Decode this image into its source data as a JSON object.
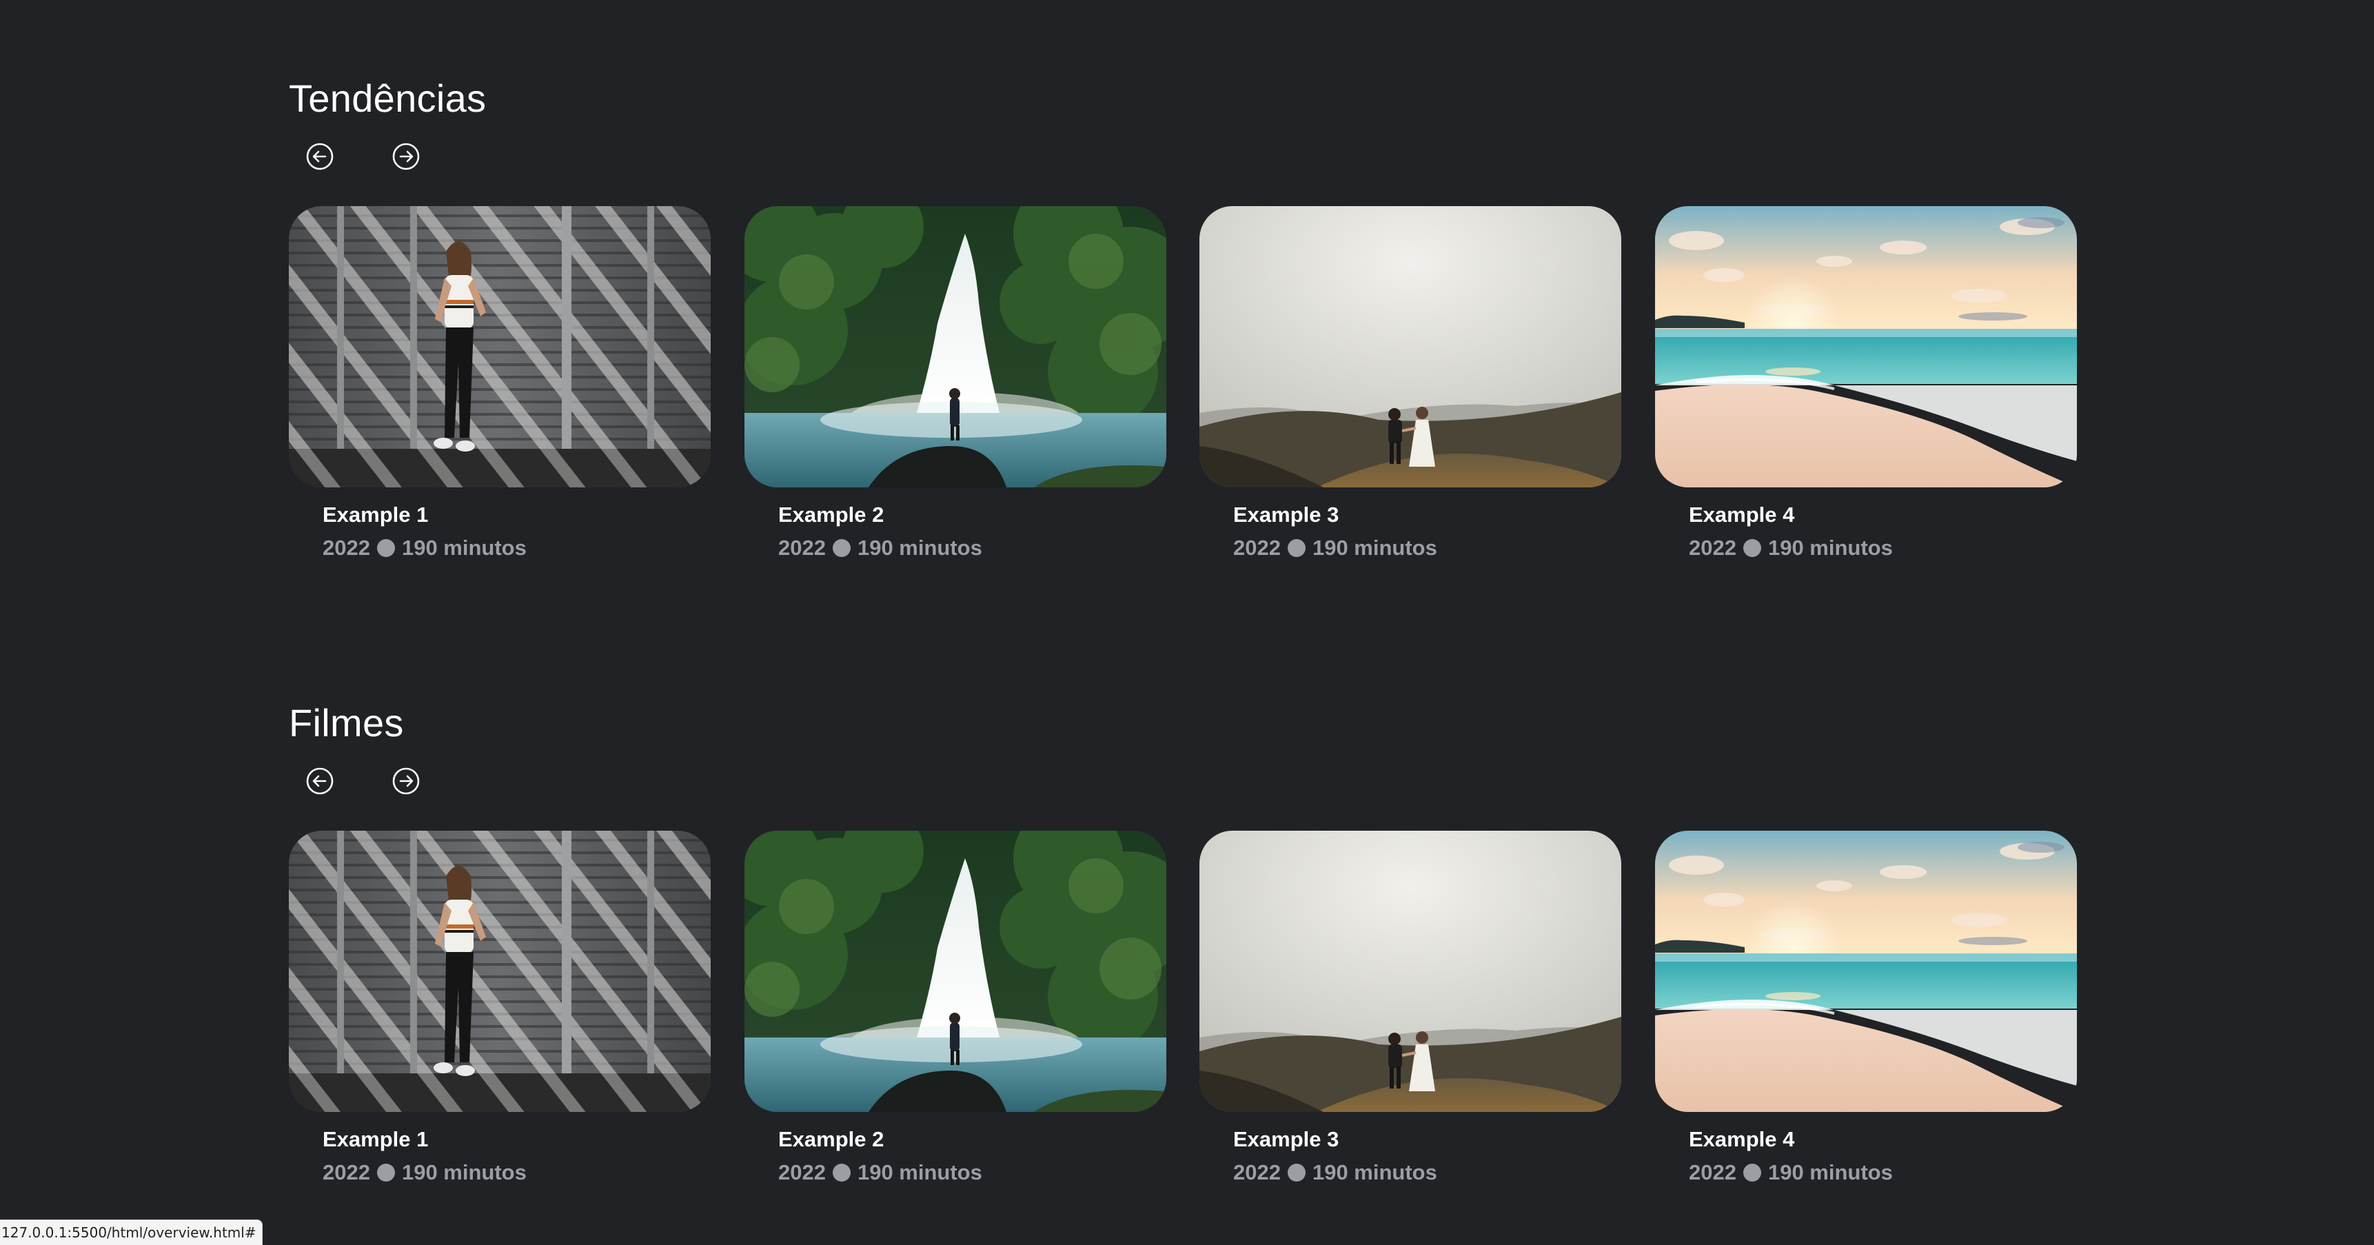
{
  "sections": [
    {
      "title": "Tendências",
      "cards": [
        {
          "title": "Example 1",
          "year": "2022",
          "duration": "190 minutos"
        },
        {
          "title": "Example 2",
          "year": "2022",
          "duration": "190 minutos"
        },
        {
          "title": "Example 3",
          "year": "2022",
          "duration": "190 minutos"
        },
        {
          "title": "Example 4",
          "year": "2022",
          "duration": "190 minutos"
        }
      ]
    },
    {
      "title": "Filmes",
      "cards": [
        {
          "title": "Example 1",
          "year": "2022",
          "duration": "190 minutos"
        },
        {
          "title": "Example 2",
          "year": "2022",
          "duration": "190 minutos"
        },
        {
          "title": "Example 3",
          "year": "2022",
          "duration": "190 minutos"
        },
        {
          "title": "Example 4",
          "year": "2022",
          "duration": "190 minutos"
        }
      ]
    }
  ],
  "icons": {
    "prev": "arrow-left-circle-icon",
    "next": "arrow-right-circle-icon",
    "separator": "dot"
  },
  "colors": {
    "background": "#202226",
    "text": "#ffffff",
    "meta_text": "#9b9ea3"
  },
  "status_bar": {
    "url": "127.0.0.1:5500/html/overview.html#"
  }
}
